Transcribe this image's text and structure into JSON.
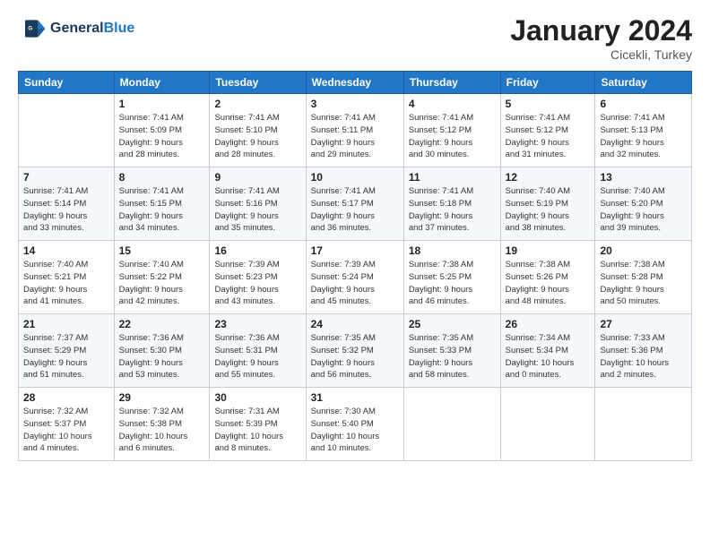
{
  "header": {
    "logo_line1": "General",
    "logo_line2": "Blue",
    "month": "January 2024",
    "location": "Cicekli, Turkey"
  },
  "columns": [
    "Sunday",
    "Monday",
    "Tuesday",
    "Wednesday",
    "Thursday",
    "Friday",
    "Saturday"
  ],
  "weeks": [
    [
      {
        "day": "",
        "detail": ""
      },
      {
        "day": "1",
        "detail": "Sunrise: 7:41 AM\nSunset: 5:09 PM\nDaylight: 9 hours\nand 28 minutes."
      },
      {
        "day": "2",
        "detail": "Sunrise: 7:41 AM\nSunset: 5:10 PM\nDaylight: 9 hours\nand 28 minutes."
      },
      {
        "day": "3",
        "detail": "Sunrise: 7:41 AM\nSunset: 5:11 PM\nDaylight: 9 hours\nand 29 minutes."
      },
      {
        "day": "4",
        "detail": "Sunrise: 7:41 AM\nSunset: 5:12 PM\nDaylight: 9 hours\nand 30 minutes."
      },
      {
        "day": "5",
        "detail": "Sunrise: 7:41 AM\nSunset: 5:12 PM\nDaylight: 9 hours\nand 31 minutes."
      },
      {
        "day": "6",
        "detail": "Sunrise: 7:41 AM\nSunset: 5:13 PM\nDaylight: 9 hours\nand 32 minutes."
      }
    ],
    [
      {
        "day": "7",
        "detail": "Sunrise: 7:41 AM\nSunset: 5:14 PM\nDaylight: 9 hours\nand 33 minutes."
      },
      {
        "day": "8",
        "detail": "Sunrise: 7:41 AM\nSunset: 5:15 PM\nDaylight: 9 hours\nand 34 minutes."
      },
      {
        "day": "9",
        "detail": "Sunrise: 7:41 AM\nSunset: 5:16 PM\nDaylight: 9 hours\nand 35 minutes."
      },
      {
        "day": "10",
        "detail": "Sunrise: 7:41 AM\nSunset: 5:17 PM\nDaylight: 9 hours\nand 36 minutes."
      },
      {
        "day": "11",
        "detail": "Sunrise: 7:41 AM\nSunset: 5:18 PM\nDaylight: 9 hours\nand 37 minutes."
      },
      {
        "day": "12",
        "detail": "Sunrise: 7:40 AM\nSunset: 5:19 PM\nDaylight: 9 hours\nand 38 minutes."
      },
      {
        "day": "13",
        "detail": "Sunrise: 7:40 AM\nSunset: 5:20 PM\nDaylight: 9 hours\nand 39 minutes."
      }
    ],
    [
      {
        "day": "14",
        "detail": "Sunrise: 7:40 AM\nSunset: 5:21 PM\nDaylight: 9 hours\nand 41 minutes."
      },
      {
        "day": "15",
        "detail": "Sunrise: 7:40 AM\nSunset: 5:22 PM\nDaylight: 9 hours\nand 42 minutes."
      },
      {
        "day": "16",
        "detail": "Sunrise: 7:39 AM\nSunset: 5:23 PM\nDaylight: 9 hours\nand 43 minutes."
      },
      {
        "day": "17",
        "detail": "Sunrise: 7:39 AM\nSunset: 5:24 PM\nDaylight: 9 hours\nand 45 minutes."
      },
      {
        "day": "18",
        "detail": "Sunrise: 7:38 AM\nSunset: 5:25 PM\nDaylight: 9 hours\nand 46 minutes."
      },
      {
        "day": "19",
        "detail": "Sunrise: 7:38 AM\nSunset: 5:26 PM\nDaylight: 9 hours\nand 48 minutes."
      },
      {
        "day": "20",
        "detail": "Sunrise: 7:38 AM\nSunset: 5:28 PM\nDaylight: 9 hours\nand 50 minutes."
      }
    ],
    [
      {
        "day": "21",
        "detail": "Sunrise: 7:37 AM\nSunset: 5:29 PM\nDaylight: 9 hours\nand 51 minutes."
      },
      {
        "day": "22",
        "detail": "Sunrise: 7:36 AM\nSunset: 5:30 PM\nDaylight: 9 hours\nand 53 minutes."
      },
      {
        "day": "23",
        "detail": "Sunrise: 7:36 AM\nSunset: 5:31 PM\nDaylight: 9 hours\nand 55 minutes."
      },
      {
        "day": "24",
        "detail": "Sunrise: 7:35 AM\nSunset: 5:32 PM\nDaylight: 9 hours\nand 56 minutes."
      },
      {
        "day": "25",
        "detail": "Sunrise: 7:35 AM\nSunset: 5:33 PM\nDaylight: 9 hours\nand 58 minutes."
      },
      {
        "day": "26",
        "detail": "Sunrise: 7:34 AM\nSunset: 5:34 PM\nDaylight: 10 hours\nand 0 minutes."
      },
      {
        "day": "27",
        "detail": "Sunrise: 7:33 AM\nSunset: 5:36 PM\nDaylight: 10 hours\nand 2 minutes."
      }
    ],
    [
      {
        "day": "28",
        "detail": "Sunrise: 7:32 AM\nSunset: 5:37 PM\nDaylight: 10 hours\nand 4 minutes."
      },
      {
        "day": "29",
        "detail": "Sunrise: 7:32 AM\nSunset: 5:38 PM\nDaylight: 10 hours\nand 6 minutes."
      },
      {
        "day": "30",
        "detail": "Sunrise: 7:31 AM\nSunset: 5:39 PM\nDaylight: 10 hours\nand 8 minutes."
      },
      {
        "day": "31",
        "detail": "Sunrise: 7:30 AM\nSunset: 5:40 PM\nDaylight: 10 hours\nand 10 minutes."
      },
      {
        "day": "",
        "detail": ""
      },
      {
        "day": "",
        "detail": ""
      },
      {
        "day": "",
        "detail": ""
      }
    ]
  ]
}
